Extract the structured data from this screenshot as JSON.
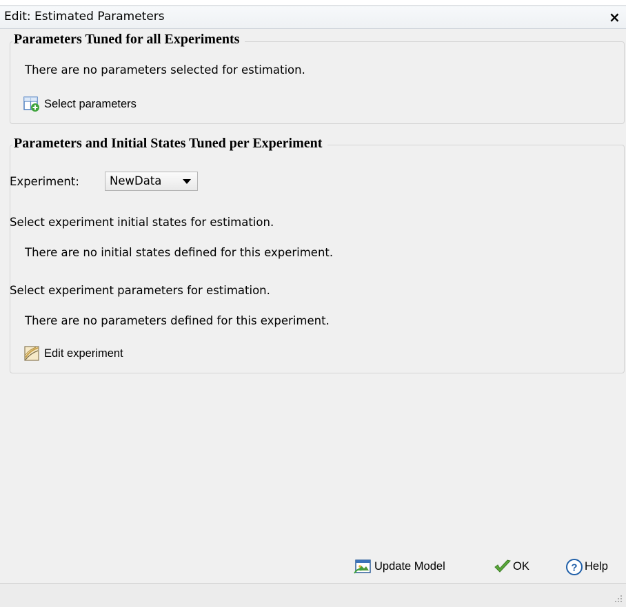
{
  "window": {
    "title": "Edit: Estimated Parameters",
    "close_glyph": "×"
  },
  "global_params": {
    "heading": "Parameters Tuned for all Experiments",
    "message": "There are no parameters selected for estimation.",
    "select_button": {
      "label": "Select parameters",
      "icon": "select-parameters-icon"
    }
  },
  "per_experiment": {
    "heading": "Parameters and Initial States Tuned per Experiment",
    "experiment_label": "Experiment:",
    "experiment_selected": "NewData",
    "initial_states_prompt": "Select experiment initial states for estimation.",
    "initial_states_message": "There are no initial states defined for this experiment.",
    "parameters_prompt": "Select experiment parameters for estimation.",
    "parameters_message": "There are no parameters defined for this experiment.",
    "edit_button": {
      "label": "Edit experiment",
      "icon": "edit-experiment-icon"
    }
  },
  "footer": {
    "update_model": {
      "label": "Update Model",
      "icon": "update-model-icon"
    },
    "ok": {
      "label": "OK",
      "icon": "checkmark-icon"
    },
    "help": {
      "label": "Help",
      "icon": "help-icon"
    }
  },
  "colors": {
    "background": "#f0f0f0",
    "ok_check": "#5aa83a",
    "help_blue": "#1f5fa8"
  }
}
